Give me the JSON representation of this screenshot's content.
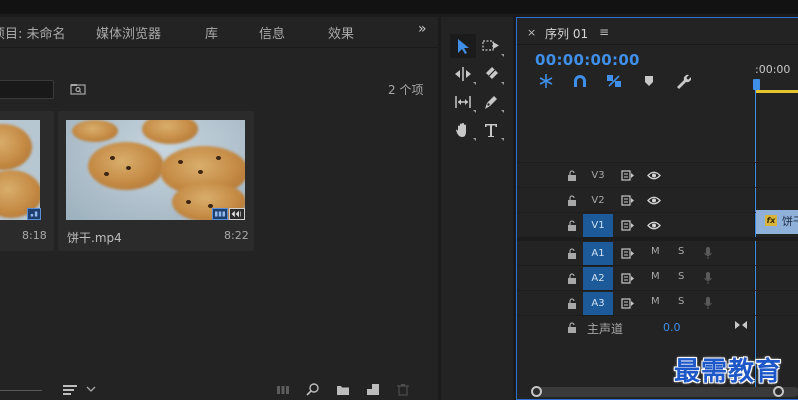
{
  "project_panel": {
    "tabs": [
      {
        "label": "项目: 未命名"
      },
      {
        "label": "媒体浏览器"
      },
      {
        "label": "库"
      },
      {
        "label": "信息"
      },
      {
        "label": "效果"
      }
    ],
    "more_tabs_label": "»",
    "item_count": "2 个项",
    "clips": [
      {
        "name": "",
        "duration": "8:18"
      },
      {
        "name": "饼干.mp4",
        "duration": "8:22"
      }
    ]
  },
  "tools": [
    {
      "icon": "selection-arrow-icon"
    },
    {
      "icon": "track-select-icon"
    },
    {
      "icon": "ripple-edit-icon"
    },
    {
      "icon": "razor-icon"
    },
    {
      "icon": "slip-icon"
    },
    {
      "icon": "pen-icon"
    },
    {
      "icon": "hand-icon"
    },
    {
      "icon": "type-icon"
    }
  ],
  "timeline": {
    "close_label": "×",
    "sequence_title": "序列 01",
    "menu_label": "≡",
    "timecode": "00:00:00:00",
    "ruler_label": ":00:00",
    "video_tracks": [
      {
        "name": "V3",
        "active": false
      },
      {
        "name": "V2",
        "active": false
      },
      {
        "name": "V1",
        "active": true
      }
    ],
    "audio_tracks": [
      {
        "name": "A1",
        "mute": "M",
        "solo": "S"
      },
      {
        "name": "A2",
        "mute": "M",
        "solo": "S"
      },
      {
        "name": "A3",
        "mute": "M",
        "solo": "S"
      }
    ],
    "clip_v1": {
      "fx_label": "fx",
      "name": "饼干"
    },
    "master": {
      "label": "主声道",
      "value": "0.0"
    },
    "colors": {
      "accent": "#3f8fe8",
      "track_active": "#1c5a9a",
      "clip": "#8fb0d9",
      "ruler_yellow": "#e6c530"
    }
  },
  "watermark": "最需教育"
}
